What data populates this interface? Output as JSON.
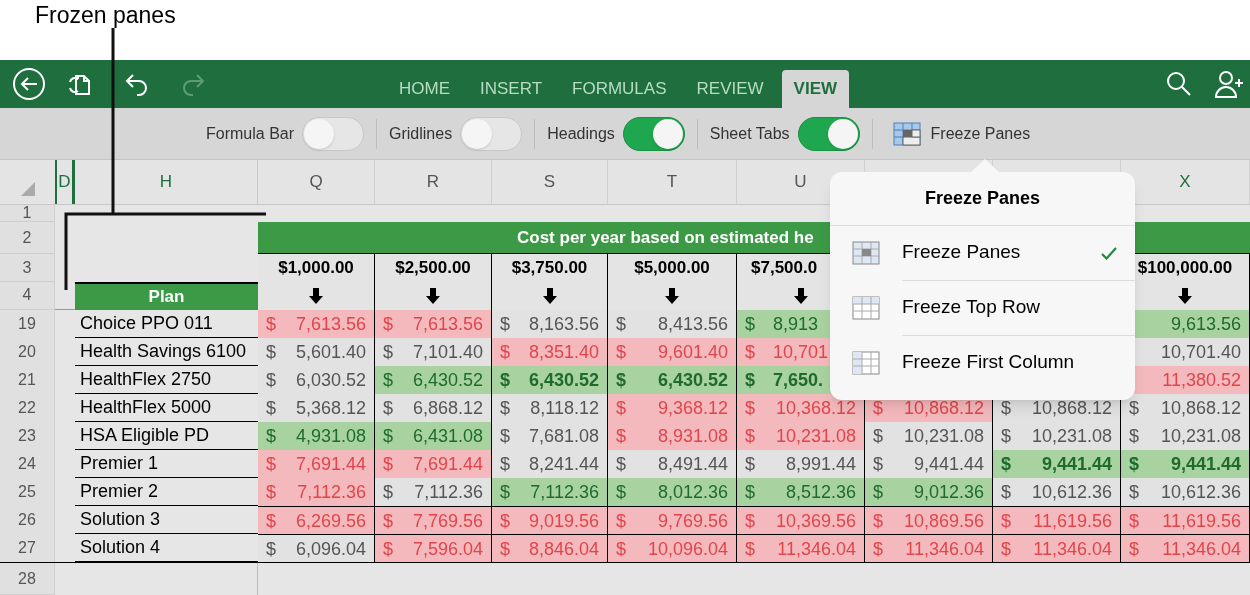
{
  "callout": {
    "label": "Frozen panes"
  },
  "app_bar": {
    "redo_disabled": true,
    "tabs": [
      {
        "label": "HOME",
        "selected": false
      },
      {
        "label": "INSERT",
        "selected": false
      },
      {
        "label": "FORMULAS",
        "selected": false
      },
      {
        "label": "REVIEW",
        "selected": false
      },
      {
        "label": "VIEW",
        "selected": true
      }
    ]
  },
  "view_options": [
    {
      "kind": "toggle",
      "label": "Formula Bar",
      "on": false
    },
    {
      "kind": "toggle",
      "label": "Gridlines",
      "on": false
    },
    {
      "kind": "toggle",
      "label": "Headings",
      "on": true
    },
    {
      "kind": "toggle",
      "label": "Sheet Tabs",
      "on": true
    },
    {
      "kind": "button",
      "label": "Freeze Panes"
    }
  ],
  "sheet": {
    "frozen_columns": [
      "D",
      "H"
    ],
    "columns": [
      {
        "letter": "Q",
        "amount": "$1,000.00"
      },
      {
        "letter": "R",
        "amount": "$2,500.00"
      },
      {
        "letter": "S",
        "amount": "$3,750.00"
      },
      {
        "letter": "T",
        "amount": "$5,000.00"
      },
      {
        "letter": "U",
        "amount": "$7,500.0",
        "clipped": true
      },
      {},
      {},
      {
        "letter": "X",
        "amount": "$100,000.00"
      }
    ],
    "header_row_numbers": [
      "1",
      "2",
      "3",
      "4"
    ],
    "banner": "Cost per year based on estimated he",
    "plan_header": "Plan",
    "rows": [
      {
        "number": "19",
        "plan": "Choice PPO 011",
        "cells": [
          {
            "symbol": "$",
            "value": "7,613.56",
            "kind": "high"
          },
          {
            "symbol": "$",
            "value": "7,613.56",
            "kind": "high"
          },
          {
            "symbol": "$",
            "value": "8,163.56",
            "kind": "normal"
          },
          {
            "symbol": "$",
            "value": "8,413.56",
            "kind": "normal"
          },
          {
            "symbol": "$",
            "value": "8,913",
            "kind": "low",
            "clipped": true
          },
          {},
          {},
          {
            "value": "9,613.56",
            "kind": "low"
          }
        ]
      },
      {
        "number": "20",
        "plan": "Health Savings 6100",
        "cells": [
          {
            "symbol": "$",
            "value": "5,601.40",
            "kind": "normal"
          },
          {
            "symbol": "$",
            "value": "7,101.40",
            "kind": "normal"
          },
          {
            "symbol": "$",
            "value": "8,351.40",
            "kind": "high"
          },
          {
            "symbol": "$",
            "value": "9,601.40",
            "kind": "high"
          },
          {
            "symbol": "$",
            "value": "10,701",
            "kind": "high",
            "clipped": true
          },
          {},
          {},
          {
            "value": "10,701.40",
            "kind": "normal"
          }
        ]
      },
      {
        "number": "21",
        "plan": "HealthFlex 2750",
        "cells": [
          {
            "symbol": "$",
            "value": "6,030.52",
            "kind": "normal"
          },
          {
            "symbol": "$",
            "value": "6,430.52",
            "kind": "low"
          },
          {
            "symbol": "$",
            "value": "6,430.52",
            "kind": "low",
            "bold": true
          },
          {
            "symbol": "$",
            "value": "6,430.52",
            "kind": "low",
            "bold": true
          },
          {
            "symbol": "$",
            "value": "7,650.",
            "kind": "low",
            "bold": true,
            "clipped": true
          },
          {},
          {},
          {
            "value": "11,380.52",
            "kind": "high"
          }
        ]
      },
      {
        "number": "22",
        "plan": "HealthFlex 5000",
        "cells": [
          {
            "symbol": "$",
            "value": "5,368.12",
            "kind": "normal"
          },
          {
            "symbol": "$",
            "value": "6,868.12",
            "kind": "normal"
          },
          {
            "symbol": "$",
            "value": "8,118.12",
            "kind": "normal"
          },
          {
            "symbol": "$",
            "value": "9,368.12",
            "kind": "high"
          },
          {
            "symbol": "$",
            "value": "10,368.12",
            "kind": "high"
          },
          {
            "symbol": "$",
            "value": "10,868.12",
            "kind": "high"
          },
          {
            "symbol": "$",
            "value": "10,868.12",
            "kind": "normal"
          },
          {
            "symbol": "$",
            "value": "10,868.12",
            "kind": "normal"
          }
        ]
      },
      {
        "number": "23",
        "plan": "HSA Eligible PD",
        "cells": [
          {
            "symbol": "$",
            "value": "4,931.08",
            "kind": "low"
          },
          {
            "symbol": "$",
            "value": "6,431.08",
            "kind": "low"
          },
          {
            "symbol": "$",
            "value": "7,681.08",
            "kind": "normal"
          },
          {
            "symbol": "$",
            "value": "8,931.08",
            "kind": "high"
          },
          {
            "symbol": "$",
            "value": "10,231.08",
            "kind": "high"
          },
          {
            "symbol": "$",
            "value": "10,231.08",
            "kind": "normal"
          },
          {
            "symbol": "$",
            "value": "10,231.08",
            "kind": "normal"
          },
          {
            "symbol": "$",
            "value": "10,231.08",
            "kind": "normal"
          }
        ]
      },
      {
        "number": "24",
        "plan": "Premier 1",
        "cells": [
          {
            "symbol": "$",
            "value": "7,691.44",
            "kind": "high"
          },
          {
            "symbol": "$",
            "value": "7,691.44",
            "kind": "high"
          },
          {
            "symbol": "$",
            "value": "8,241.44",
            "kind": "normal"
          },
          {
            "symbol": "$",
            "value": "8,491.44",
            "kind": "normal"
          },
          {
            "symbol": "$",
            "value": "8,991.44",
            "kind": "normal"
          },
          {
            "symbol": "$",
            "value": "9,441.44",
            "kind": "normal"
          },
          {
            "symbol": "$",
            "value": "9,441.44",
            "kind": "low",
            "bold": true
          },
          {
            "symbol": "$",
            "value": "9,441.44",
            "kind": "low",
            "bold": true
          }
        ]
      },
      {
        "number": "25",
        "plan": "Premier 2",
        "cells": [
          {
            "symbol": "$",
            "value": "7,112.36",
            "kind": "high"
          },
          {
            "symbol": "$",
            "value": "7,112.36",
            "kind": "normal"
          },
          {
            "symbol": "$",
            "value": "7,112.36",
            "kind": "low"
          },
          {
            "symbol": "$",
            "value": "8,012.36",
            "kind": "low"
          },
          {
            "symbol": "$",
            "value": "8,512.36",
            "kind": "low"
          },
          {
            "symbol": "$",
            "value": "9,012.36",
            "kind": "low"
          },
          {
            "symbol": "$",
            "value": "10,612.36",
            "kind": "normal"
          },
          {
            "symbol": "$",
            "value": "10,612.36",
            "kind": "normal"
          }
        ]
      },
      {
        "number": "26",
        "plan": "Solution 3",
        "cells": [
          {
            "symbol": "$",
            "value": "6,269.56",
            "kind": "high"
          },
          {
            "symbol": "$",
            "value": "7,769.56",
            "kind": "high"
          },
          {
            "symbol": "$",
            "value": "9,019.56",
            "kind": "high"
          },
          {
            "symbol": "$",
            "value": "9,769.56",
            "kind": "high"
          },
          {
            "symbol": "$",
            "value": "10,369.56",
            "kind": "high"
          },
          {
            "symbol": "$",
            "value": "10,869.56",
            "kind": "high"
          },
          {
            "symbol": "$",
            "value": "11,619.56",
            "kind": "high"
          },
          {
            "symbol": "$",
            "value": "11,619.56",
            "kind": "high"
          }
        ]
      },
      {
        "number": "27",
        "plan": "Solution 4",
        "cells": [
          {
            "symbol": "$",
            "value": "6,096.04",
            "kind": "normal"
          },
          {
            "symbol": "$",
            "value": "7,596.04",
            "kind": "high"
          },
          {
            "symbol": "$",
            "value": "8,846.04",
            "kind": "high"
          },
          {
            "symbol": "$",
            "value": "10,096.04",
            "kind": "high"
          },
          {
            "symbol": "$",
            "value": "11,346.04",
            "kind": "high"
          },
          {
            "symbol": "$",
            "value": "11,346.04",
            "kind": "high"
          },
          {
            "symbol": "$",
            "value": "11,346.04",
            "kind": "high"
          },
          {
            "symbol": "$",
            "value": "11,346.04",
            "kind": "high"
          }
        ]
      }
    ],
    "last_row_number": "28"
  },
  "freeze_menu": {
    "title": "Freeze Panes",
    "items": [
      {
        "label": "Freeze Panes",
        "selected": true
      },
      {
        "label": "Freeze Top Row",
        "selected": false
      },
      {
        "label": "Freeze First Column",
        "selected": false
      }
    ]
  }
}
